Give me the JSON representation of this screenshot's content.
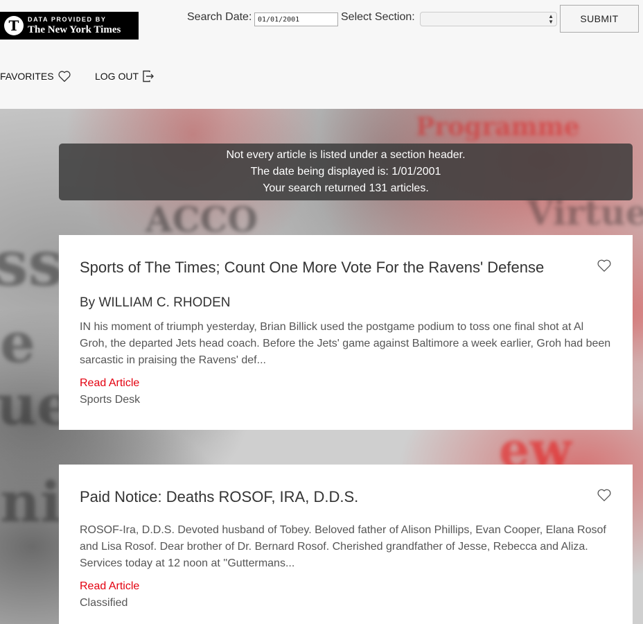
{
  "header": {
    "logo": {
      "line1": "DATA PROVIDED BY",
      "line2": "The New York Times"
    },
    "search_date_label": "Search Date:",
    "search_date_value": "01/01/2001",
    "select_section_label": "Select Section:",
    "select_section_value": "",
    "submit_label": "SUBMIT"
  },
  "nav": {
    "favorites_label": "FAVORITES",
    "logout_label": "LOG OUT"
  },
  "info": {
    "line1": "Not every article is listed under a section header.",
    "line2": "The date being displayed is: 1/01/2001",
    "line3": "Your search returned 131 articles."
  },
  "articles": [
    {
      "title": "Sports of The Times; Count One More Vote For the Ravens' Defense",
      "byline": "By WILLIAM C. RHODEN",
      "abstract": "IN his moment of triumph yesterday, Brian Billick used the postgame podium to toss one final shot at Al Groh, the departed Jets head coach. Before the Jets' game against Baltimore a week earlier, Groh had been sarcastic in praising the Ravens' def...",
      "link_label": "Read Article",
      "section": "Sports Desk"
    },
    {
      "title": "Paid Notice: Deaths ROSOF, IRA, D.D.S.",
      "byline": "",
      "abstract": "ROSOF-Ira, D.D.S. Devoted husband of Tobey. Beloved father of Alison Phillips, Evan Cooper, Elana Rosof and Lisa Rosof. Dear brother of Dr. Bernard Rosof. Cherished grandfather of Jesse, Rebecca and Aliza. Services today at 12 noon at ''Guttermans...",
      "link_label": "Read Article",
      "section": "Classified"
    }
  ],
  "colors": {
    "link": "#e3000f",
    "info_bg": "#3c3c3c"
  },
  "icons": {
    "favorite": "heart-icon",
    "logout": "logout-icon"
  }
}
